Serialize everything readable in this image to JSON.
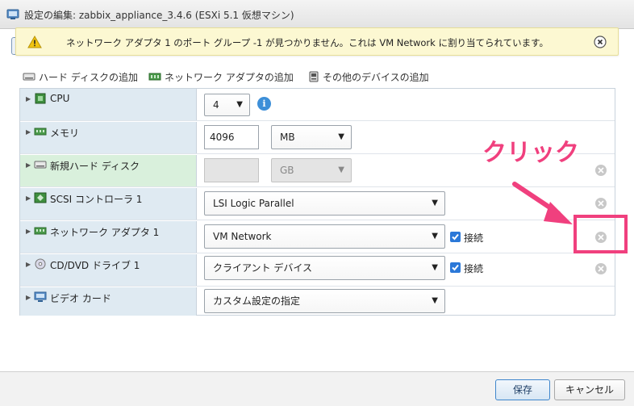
{
  "window": {
    "title": "設定の編集: zabbix_appliance_3.4.6 (ESXi 5.1 仮想マシン)"
  },
  "warning": {
    "message": "ネットワーク アダプタ 1 のポート グループ -1 が見つかりません。これは VM Network に割り当てられています。"
  },
  "toolbar": {
    "add_hard_disk": "ハード ディスクの追加",
    "add_network_adapter": "ネットワーク アダプタの追加",
    "add_other_device": "その他のデバイスの追加"
  },
  "devices": {
    "cpu": {
      "label": "CPU",
      "value": "4"
    },
    "memory": {
      "label": "メモリ",
      "value": "4096",
      "unit": "MB"
    },
    "new_disk": {
      "label": "新規ハード ディスク",
      "unit": "GB"
    },
    "scsi": {
      "label": "SCSI コントローラ 1",
      "value": "LSI Logic Parallel"
    },
    "network": {
      "label": "ネットワーク アダプタ 1",
      "value": "VM Network",
      "connect_label": "接続",
      "connected": true
    },
    "cddvd": {
      "label": "CD/DVD ドライブ 1",
      "value": "クライアント デバイス",
      "connect_label": "接続",
      "connected": true
    },
    "video": {
      "label": "ビデオ カード",
      "value": "カスタム設定の指定"
    }
  },
  "annotation": {
    "text": "クリック",
    "color": "#f0407e"
  },
  "footer": {
    "save_label": "保存",
    "cancel_label": "キャンセル"
  }
}
